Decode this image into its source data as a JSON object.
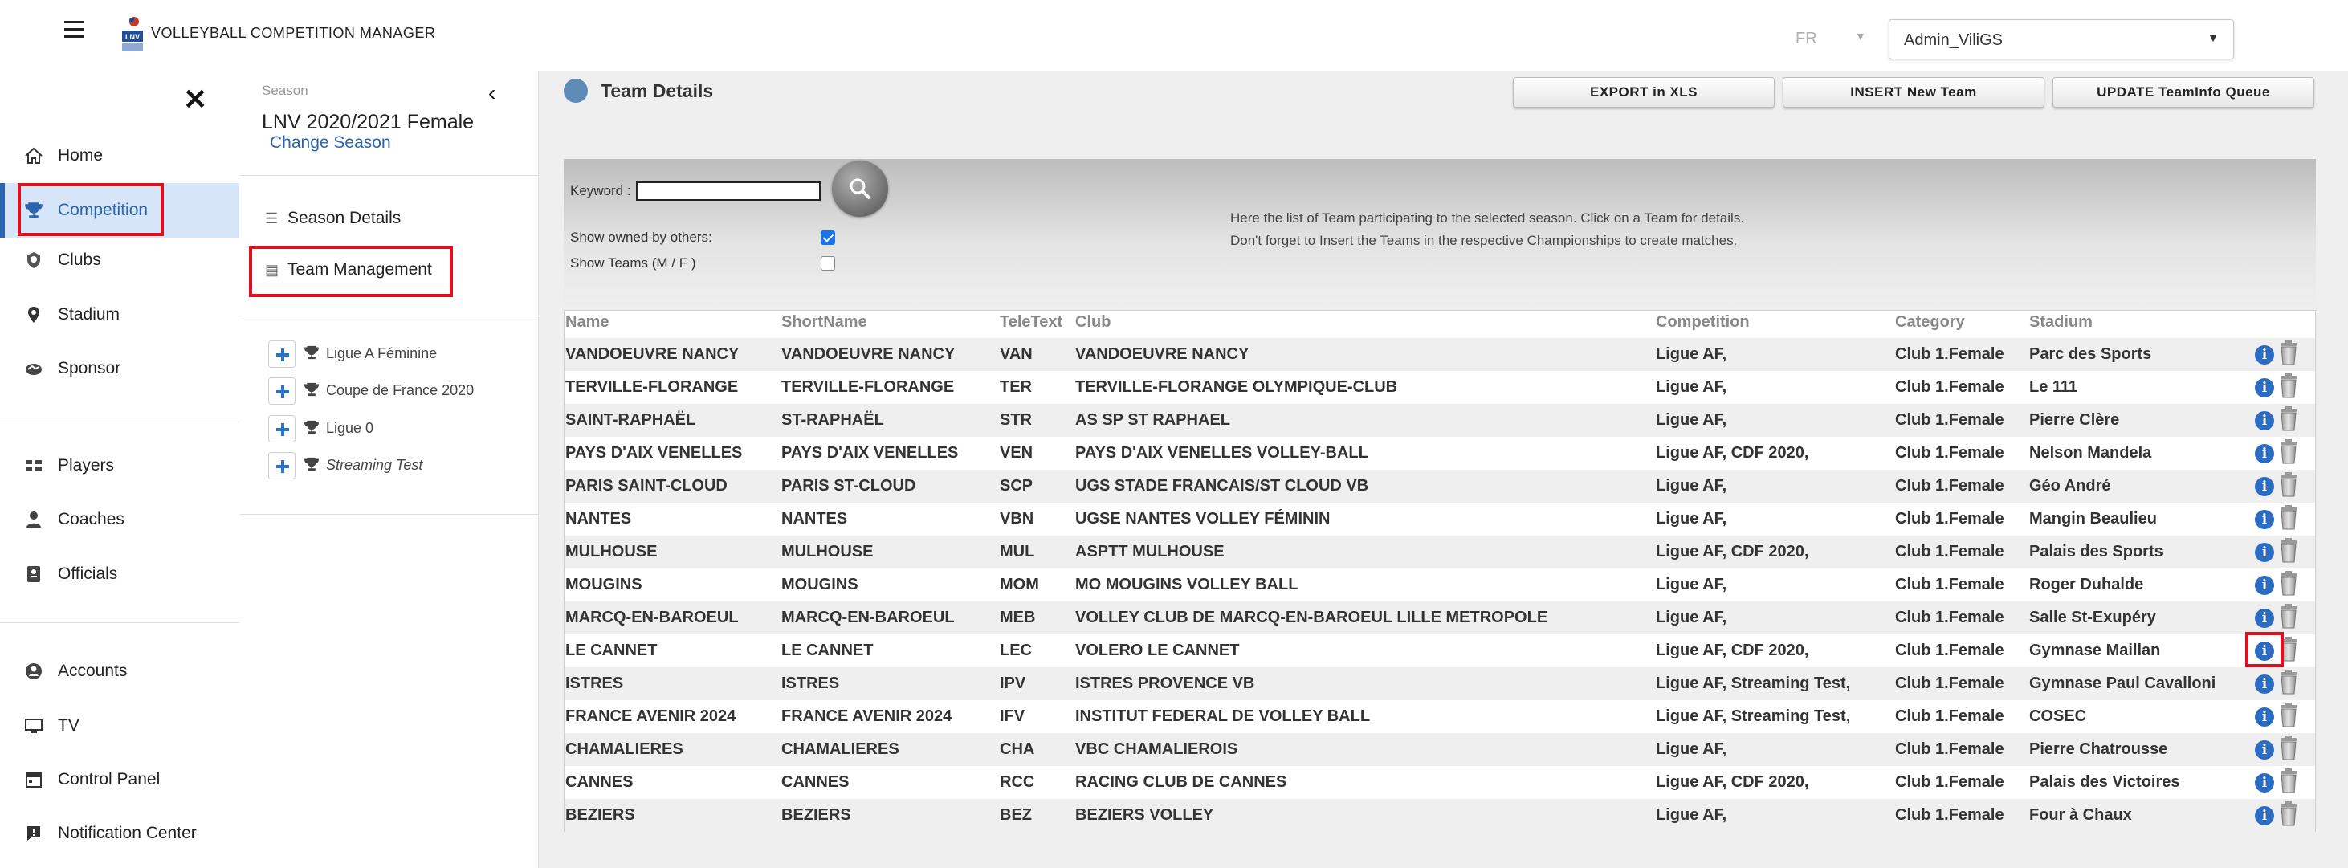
{
  "header": {
    "app_title": "VOLLEYBALL COMPETITION MANAGER",
    "language": "FR",
    "user": "Admin_ViliGS"
  },
  "sidebar": {
    "items": [
      {
        "label": "Home",
        "icon": "home-icon"
      },
      {
        "label": "Competition",
        "icon": "trophy-icon"
      },
      {
        "label": "Clubs",
        "icon": "shield-icon"
      },
      {
        "label": "Stadium",
        "icon": "map-pin-icon"
      },
      {
        "label": "Sponsor",
        "icon": "handshake-icon"
      },
      {
        "label": "Players",
        "icon": "players-icon"
      },
      {
        "label": "Coaches",
        "icon": "coach-icon"
      },
      {
        "label": "Officials",
        "icon": "badge-icon"
      },
      {
        "label": "Accounts",
        "icon": "user-icon"
      },
      {
        "label": "TV",
        "icon": "monitor-icon"
      },
      {
        "label": "Control Panel",
        "icon": "calendar-icon"
      },
      {
        "label": "Notification Center",
        "icon": "alert-icon"
      }
    ]
  },
  "season_panel": {
    "label": "Season",
    "name": "LNV 2020/2021 Female",
    "change_label": "Change Season",
    "season_details": "Season Details",
    "team_management": "Team Management",
    "championships": [
      {
        "name": "Ligue A Féminine",
        "italic": false
      },
      {
        "name": "Coupe de France 2020",
        "italic": false
      },
      {
        "name": "Ligue 0",
        "italic": false
      },
      {
        "name": "Streaming Test",
        "italic": true
      }
    ]
  },
  "main": {
    "title": "Team Details",
    "buttons": {
      "export": "EXPORT in XLS",
      "insert": "INSERT New Team",
      "update": "UPDATE TeamInfo Queue"
    },
    "filter": {
      "keyword_label": "Keyword :",
      "keyword_value": "",
      "owned_label": "Show owned by others:",
      "owned_checked": true,
      "mf_label": "Show Teams (M / F )",
      "mf_checked": false,
      "info_line1": "Here the list of Team participating to the selected season. Click on a Team for details.",
      "info_line2": "Don't forget to Insert the Teams in the respective Championships to create matches."
    },
    "columns": [
      "Name",
      "ShortName",
      "TeleText",
      "Club",
      "Competition",
      "Category",
      "Stadium"
    ],
    "rows": [
      [
        "VANDOEUVRE NANCY",
        "VANDOEUVRE NANCY",
        "VAN",
        "VANDOEUVRE NANCY",
        "Ligue AF,",
        "Club 1.Female",
        "Parc des Sports"
      ],
      [
        "TERVILLE-FLORANGE",
        "TERVILLE-FLORANGE",
        "TER",
        "TERVILLE-FLORANGE OLYMPIQUE-CLUB",
        "Ligue AF,",
        "Club 1.Female",
        "Le 111"
      ],
      [
        "SAINT-RAPHAËL",
        "ST-RAPHAËL",
        "STR",
        "AS SP ST RAPHAEL",
        "Ligue AF,",
        "Club 1.Female",
        "Pierre Clère"
      ],
      [
        "PAYS D'AIX VENELLES",
        "PAYS D'AIX VENELLES",
        "VEN",
        "PAYS D'AIX VENELLES VOLLEY-BALL",
        "Ligue AF, CDF 2020,",
        "Club 1.Female",
        "Nelson Mandela"
      ],
      [
        "PARIS SAINT-CLOUD",
        "PARIS ST-CLOUD",
        "SCP",
        "UGS STADE FRANCAIS/ST CLOUD VB",
        "Ligue AF,",
        "Club 1.Female",
        "Géo André"
      ],
      [
        "NANTES",
        "NANTES",
        "VBN",
        "UGSE NANTES VOLLEY FÉMININ",
        "Ligue AF,",
        "Club 1.Female",
        "Mangin Beaulieu"
      ],
      [
        "MULHOUSE",
        "MULHOUSE",
        "MUL",
        "ASPTT MULHOUSE",
        "Ligue AF, CDF 2020,",
        "Club 1.Female",
        "Palais des Sports"
      ],
      [
        "MOUGINS",
        "MOUGINS",
        "MOM",
        "MO MOUGINS VOLLEY BALL",
        "Ligue AF,",
        "Club 1.Female",
        "Roger Duhalde"
      ],
      [
        "MARCQ-EN-BAROEUL",
        "MARCQ-EN-BAROEUL",
        "MEB",
        "VOLLEY CLUB DE MARCQ-EN-BAROEUL LILLE METROPOLE",
        "Ligue AF,",
        "Club 1.Female",
        "Salle St-Exupéry"
      ],
      [
        "LE CANNET",
        "LE CANNET",
        "LEC",
        "VOLERO LE CANNET",
        "Ligue AF, CDF 2020,",
        "Club 1.Female",
        "Gymnase Maillan"
      ],
      [
        "ISTRES",
        "ISTRES",
        "IPV",
        "ISTRES PROVENCE VB",
        "Ligue AF, Streaming Test,",
        "Club 1.Female",
        "Gymnase Paul Cavalloni"
      ],
      [
        "FRANCE AVENIR 2024",
        "FRANCE AVENIR 2024",
        "IFV",
        "INSTITUT FEDERAL DE VOLLEY BALL",
        "Ligue AF, Streaming Test,",
        "Club 1.Female",
        "COSEC"
      ],
      [
        "CHAMALIERES",
        "CHAMALIERES",
        "CHA",
        "VBC CHAMALIEROIS",
        "Ligue AF,",
        "Club 1.Female",
        "Pierre Chatrousse"
      ],
      [
        "CANNES",
        "CANNES",
        "RCC",
        "RACING CLUB DE CANNES",
        "Ligue AF, CDF 2020,",
        "Club 1.Female",
        "Palais des Victoires"
      ],
      [
        "BEZIERS",
        "BEZIERS",
        "BEZ",
        "BEZIERS VOLLEY",
        "Ligue AF,",
        "Club 1.Female",
        "Four à Chaux"
      ]
    ]
  }
}
